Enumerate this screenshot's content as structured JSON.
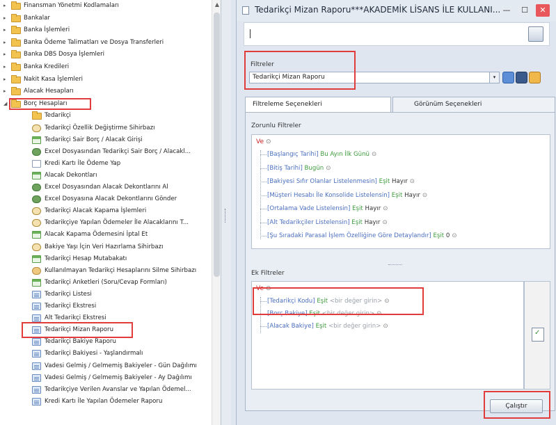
{
  "tree": {
    "top_items": [
      {
        "label": "Finansman Yönetmi Kodlamaları",
        "arrow": "▸"
      },
      {
        "label": "Bankalar",
        "arrow": "▸"
      },
      {
        "label": "Banka İşlemleri",
        "arrow": "▸"
      },
      {
        "label": "Banka Ödeme Talimatları ve Dosya Transferleri",
        "arrow": "▸"
      },
      {
        "label": "Banka DBS Dosya İşlemleri",
        "arrow": "▸"
      },
      {
        "label": "Banka Kredileri",
        "arrow": "▸"
      },
      {
        "label": "Nakit Kasa İşlemleri",
        "arrow": "▸"
      },
      {
        "label": "Alacak Hesapları",
        "arrow": "▸"
      },
      {
        "label": "Borç Hesapları",
        "arrow": "◢"
      }
    ],
    "children": [
      {
        "label": "Tedarikçi",
        "icon": "folder"
      },
      {
        "label": "Tedarikçi Özellik Değiştirme Sihirbazı",
        "icon": "wizard"
      },
      {
        "label": "Tedarikçi Sair Borç / Alacak Girişi",
        "icon": "form"
      },
      {
        "label": "Excel Dosyasından Tedarikçi Sair Borç / Alacakl...",
        "icon": "excel"
      },
      {
        "label": "Kredi Kartı İle Ödeme Yap",
        "icon": "doc"
      },
      {
        "label": "Alacak Dekontları",
        "icon": "form"
      },
      {
        "label": "Excel Dosyasından Alacak Dekontlarını Al",
        "icon": "excel"
      },
      {
        "label": "Excel Dosyasına Alacak Dekontlarını Gönder",
        "icon": "excel"
      },
      {
        "label": "Tedarikçi Alacak Kapama İşlemleri",
        "icon": "wizard"
      },
      {
        "label": "Tedarikçiye Yapılan Ödemeler İle Alacaklarını T...",
        "icon": "wizard"
      },
      {
        "label": "Alacak Kapama Ödemesini İptal Et",
        "icon": "form"
      },
      {
        "label": "Bakiye Yaşı İçin Veri Hazırlama Sihirbazı",
        "icon": "wizard"
      },
      {
        "label": "Tedarikçi Hesap Mutabakatı",
        "icon": "form"
      },
      {
        "label": "Kullanılmayan Tedarikçi Hesaplarını Silme Sihirbazı",
        "icon": "user"
      },
      {
        "label": "Tedarikçi Anketleri (Soru/Cevap Formları)",
        "icon": "form"
      },
      {
        "label": "Tedarikçi Listesi",
        "icon": "report"
      },
      {
        "label": "Tedarikçi Ekstresi",
        "icon": "report"
      },
      {
        "label": "Alt Tedarikçi Ekstresi",
        "icon": "report"
      },
      {
        "label": "Tedarikçi Mizan Raporu",
        "icon": "report"
      },
      {
        "label": "Tedarikçi Bakiye Raporu",
        "icon": "report"
      },
      {
        "label": "Tedarikçi Bakiyesi - Yaşlandırmalı",
        "icon": "report"
      },
      {
        "label": "Vadesi Gelmiş / Gelmemiş Bakiyeler - Gün Dağılımı",
        "icon": "report"
      },
      {
        "label": "Vadesi Gelmiş / Gelmemiş Bakiyeler - Ay Dağılımı",
        "icon": "report"
      },
      {
        "label": "Tedarikçiye Verilen Avanslar ve Yapılan Ödemel...",
        "icon": "report"
      },
      {
        "label": "Kredi Kartı İle Yapılan Ödemeler Raporu",
        "icon": "report"
      }
    ]
  },
  "window": {
    "title": "Tedarikçi Mizan Raporu***AKADEMİK LİSANS İLE KULLANI...",
    "minimize": "—",
    "maximize": "☐",
    "close": "✕"
  },
  "filters": {
    "label": "Filtreler",
    "selected": "Tedarikçi Mizan Raporu",
    "drop": "▾"
  },
  "tabs": {
    "filter_options": "Filtreleme Seçenekleri",
    "view_options": "Görünüm Seçenekleri"
  },
  "required": {
    "title": "Zorunlu Filtreler",
    "ve": "Ve",
    "rows": [
      {
        "field": "[Başlangıç Tarihi]",
        "op": "",
        "value": "Bu Ayın İlk Günü",
        "style": "blue"
      },
      {
        "field": "[Bitiş Tarihi]",
        "op": "",
        "value": "Bugün",
        "style": "blue"
      },
      {
        "field": "[Bakiyesi Sıfır Olanlar Listelenmesin]",
        "op": "Eşit",
        "value": "Hayır",
        "style": "dark"
      },
      {
        "field": "[Müşteri Hesabı İle Konsolide Listelensin]",
        "op": "Eşit",
        "value": "Hayır",
        "style": "dark"
      },
      {
        "field": "[Ortalama Vade Listelensin]",
        "op": "Eşit",
        "value": "Hayır",
        "style": "dark"
      },
      {
        "field": "[Alt Tedarikçiler Listelensin]",
        "op": "Eşit",
        "value": "Hayır",
        "style": "dark"
      },
      {
        "field": "[Şu Sıradaki Parasal İşlem Özelliğine Göre Detaylandır]",
        "op": "Eşit",
        "value": "0",
        "style": "dark"
      }
    ]
  },
  "extra": {
    "title": "Ek Filtreler",
    "ve": "Ve",
    "rows": [
      {
        "field": "[Tedarikçi Kodu]",
        "op": "Eşit",
        "value": "<bir değer girin>"
      },
      {
        "field": "[Borç Bakiye]",
        "op": "Eşit",
        "value": "<bir değer girin>"
      },
      {
        "field": "[Alacak Bakiye]",
        "op": "Eşit",
        "value": "<bir değer girin>"
      }
    ]
  },
  "run_button": "Çalıştır",
  "add_symbol": "⊙"
}
